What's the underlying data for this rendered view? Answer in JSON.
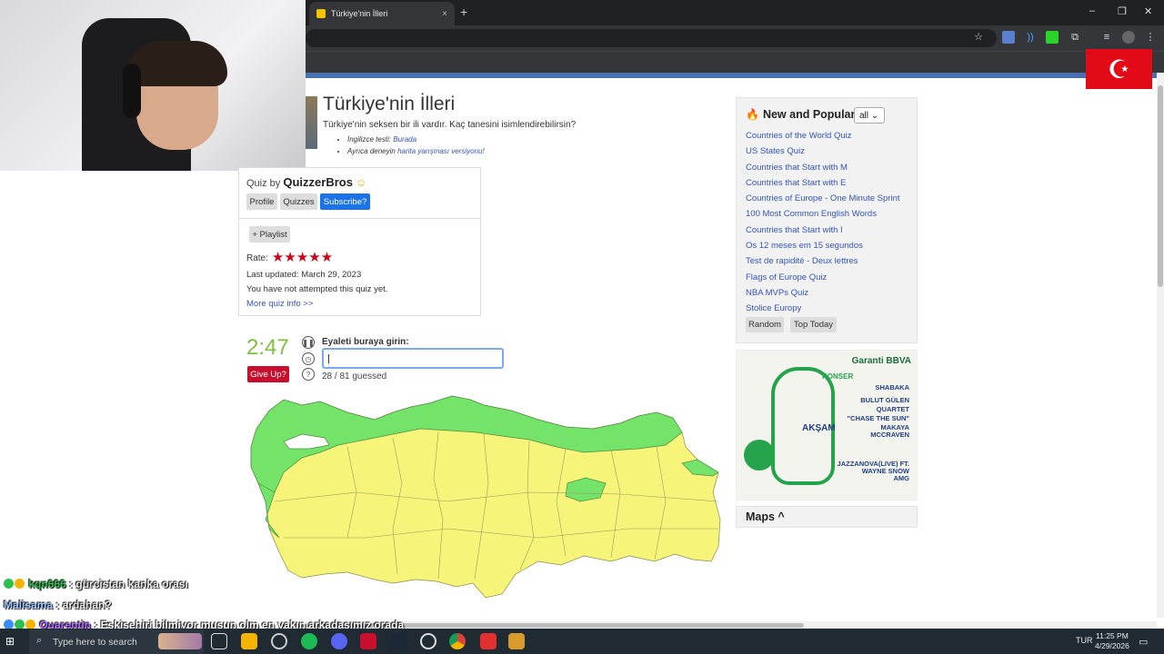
{
  "browser": {
    "tab_title": "Türkiye'nin İlleri",
    "tab_close": "×",
    "new_tab": "+",
    "win_min": "–",
    "win_max": "❐",
    "win_close": "✕"
  },
  "page": {
    "title": "Türkiye'nin İlleri",
    "subtitle": "Türkiye'nin seksen bir ili vardır. Kaç tanesini isimlendirebilirsin?",
    "bullet1_prefix": "İngilizce testi: ",
    "bullet1_link": "Burada",
    "bullet2_prefix": "Ayrıca deneyin ",
    "bullet2_link": "harita yarışması versiyonu!"
  },
  "quiz_info": {
    "by_label": "Quiz by ",
    "author": "QuizzerBros",
    "profile": "Profile",
    "quizzes": "Quizzes",
    "subscribe": "Subscribe?",
    "playlist": "+ Playlist",
    "rate_label": "Rate:",
    "rating_stars": 5,
    "last_updated": "Last updated: March 29, 2023",
    "attempt_status": "You have not attempted this quiz yet.",
    "more_info": "More quiz info >>"
  },
  "game": {
    "timer": "2:47",
    "give_up": "Give Up?",
    "input_label": "Eyaleti buraya girin:",
    "input_value": "|",
    "guessed": "28 / 81 guessed",
    "guessed_count": 28,
    "total": 81
  },
  "sidebar": {
    "heading": "New and Popular",
    "filter": "all",
    "links": [
      "Countries of the World Quiz",
      "US States Quiz",
      "Countries that Start with M",
      "Countries that Start with E",
      "Countries of Europe - One Minute Sprint",
      "100 Most Common English Words",
      "Countries that Start with I",
      "Os 12 meses em 15 segundos",
      "Test de rapidité - Deux lettres",
      "Flags of Europe Quiz",
      "NBA MVPs Quiz",
      "Stolice Europy"
    ],
    "random": "Random",
    "top_today": "Top Today"
  },
  "ad": {
    "brand": "Garanti BBVA",
    "konser": "KONSER",
    "aksam": "AKŞAM",
    "lines": [
      "SHABAKA",
      "BULUT GÜLEN",
      "QUARTET",
      "\"CHASE THE SUN\"",
      "MAKAYA",
      "MCCRAVEN",
      "JAZZANOVA(LIVE) FT.",
      "WAYNE SNOW",
      "AMG"
    ]
  },
  "maps_section": {
    "label": "Maps ^"
  },
  "chat": [
    {
      "user": "kqn666",
      "message": " : gürcistan kanka orası"
    },
    {
      "user": "Malisama",
      "message": " : ardahan?"
    },
    {
      "user": "Quarentin",
      "message": " : Eskişehiri bilmiyor musun olm en yakın arkadaşımız orada"
    }
  ],
  "taskbar": {
    "search_placeholder": "Type here to search",
    "lang": "TUR",
    "time": "11:25 PM",
    "date": "4/29/2026"
  },
  "colors": {
    "guessed": "#74e36a",
    "unguessed": "#f6f57a",
    "accent": "#1a73e8",
    "give_up": "#c8102e",
    "timer": "#7fbf3f"
  }
}
